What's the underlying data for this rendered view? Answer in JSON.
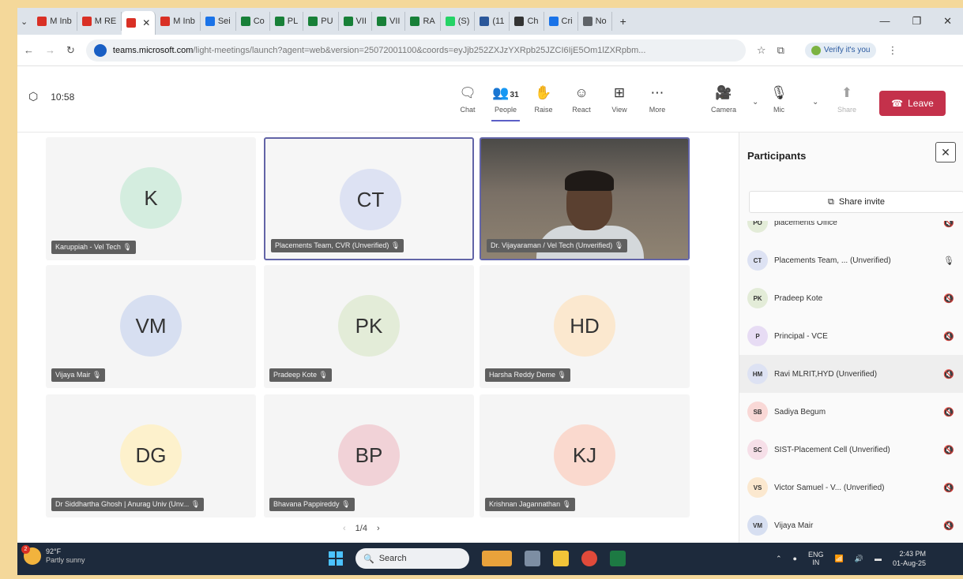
{
  "browser": {
    "tabs": [
      {
        "label": "M Inb",
        "color": "#d93025",
        "active": false
      },
      {
        "label": "M RE",
        "color": "#d93025",
        "active": false
      },
      {
        "label": "",
        "color": "#d93025",
        "active": true
      },
      {
        "label": "M Inb",
        "color": "#d93025",
        "active": false
      },
      {
        "label": "Sei",
        "color": "#1a73e8",
        "active": false
      },
      {
        "label": "Co",
        "color": "#188038",
        "active": false
      },
      {
        "label": "PL",
        "color": "#188038",
        "active": false
      },
      {
        "label": "PU",
        "color": "#188038",
        "active": false
      },
      {
        "label": "VII",
        "color": "#188038",
        "active": false
      },
      {
        "label": "VII",
        "color": "#188038",
        "active": false
      },
      {
        "label": "RA",
        "color": "#188038",
        "active": false
      },
      {
        "label": "(S)",
        "color": "#25d366",
        "active": false
      },
      {
        "label": "(11",
        "color": "#2b579a",
        "active": false
      },
      {
        "label": "Ch",
        "color": "#333333",
        "active": false
      },
      {
        "label": "Cri",
        "color": "#1a73e8",
        "active": false
      },
      {
        "label": "No",
        "color": "#5f6368",
        "active": false
      }
    ],
    "new_tab": "+",
    "url_host": "teams.microsoft.com",
    "url_rest": "/light-meetings/launch?agent=web&version=25072001100&coords=eyJjb252ZXJzYXRpb25JZCI6IjE5Om1lZXRpbm...",
    "verify_label": "Verify it's you"
  },
  "meeting": {
    "timer": "10:58",
    "toolbar": {
      "chat": "Chat",
      "people": "People",
      "people_count": "31",
      "raise": "Raise",
      "react": "React",
      "view": "View",
      "more": "More",
      "camera": "Camera",
      "mic": "Mic",
      "share": "Share",
      "leave": "Leave"
    },
    "tiles": [
      {
        "initials": "K",
        "name": "Karuppiah - Vel Tech",
        "avatar_color": "#d4eddf"
      },
      {
        "initials": "CT",
        "name": "Placements Team, CVR (Unverified)",
        "avatar_color": "#dde2f3"
      },
      {
        "initials": "",
        "name": "Dr. Vijayaraman / Vel Tech (Unverified)",
        "avatar_color": ""
      },
      {
        "initials": "VM",
        "name": "Vijaya Mair",
        "avatar_color": "#d7dff1"
      },
      {
        "initials": "PK",
        "name": "Pradeep Kote",
        "avatar_color": "#e3ecd8"
      },
      {
        "initials": "HD",
        "name": "Harsha Reddy Deme",
        "avatar_color": "#fbe8cf"
      },
      {
        "initials": "DG",
        "name": "Dr Siddhartha Ghosh | Anurag Univ (Unv...",
        "avatar_color": "#fdf1cc"
      },
      {
        "initials": "BP",
        "name": "Bhavana Pappireddy",
        "avatar_color": "#f1d2d7"
      },
      {
        "initials": "KJ",
        "name": "Krishnan Jagannathan",
        "avatar_color": "#fad9ce"
      }
    ],
    "pager": "1/4"
  },
  "participants": {
    "title": "Participants",
    "share_invite": "Share invite",
    "list": [
      {
        "initials": "PO",
        "name": "placements Office",
        "avatar_color": "#e3ecd8",
        "mic": "muted"
      },
      {
        "initials": "CT",
        "name": "Placements Team, ... (Unverified)",
        "avatar_color": "#dde2f3",
        "mic": "on"
      },
      {
        "initials": "PK",
        "name": "Pradeep Kote",
        "avatar_color": "#e3ecd8",
        "mic": "muted"
      },
      {
        "initials": "P",
        "name": "Principal - VCE",
        "avatar_color": "#e7dcf4",
        "mic": "muted"
      },
      {
        "initials": "HM",
        "name": "Ravi MLRIT,HYD (Unverified)",
        "avatar_color": "#dde2f3",
        "mic": "muted"
      },
      {
        "initials": "SB",
        "name": "Sadiya Begum",
        "avatar_color": "#f9d8d6",
        "mic": "muted"
      },
      {
        "initials": "SC",
        "name": "SIST-Placement Cell (Unverified)",
        "avatar_color": "#f6dfe8",
        "mic": "muted"
      },
      {
        "initials": "VS",
        "name": "Victor Samuel - V... (Unverified)",
        "avatar_color": "#fbe8cf",
        "mic": "muted"
      },
      {
        "initials": "VM",
        "name": "Vijaya Mair",
        "avatar_color": "#d7dff1",
        "mic": "muted"
      }
    ]
  },
  "taskbar": {
    "temperature": "92°F",
    "weather": "Partly sunny",
    "notification_count": "2",
    "search": "Search",
    "lang": "ENG",
    "lang_region": "IN",
    "time": "2:43 PM",
    "date": "01-Aug-25"
  }
}
